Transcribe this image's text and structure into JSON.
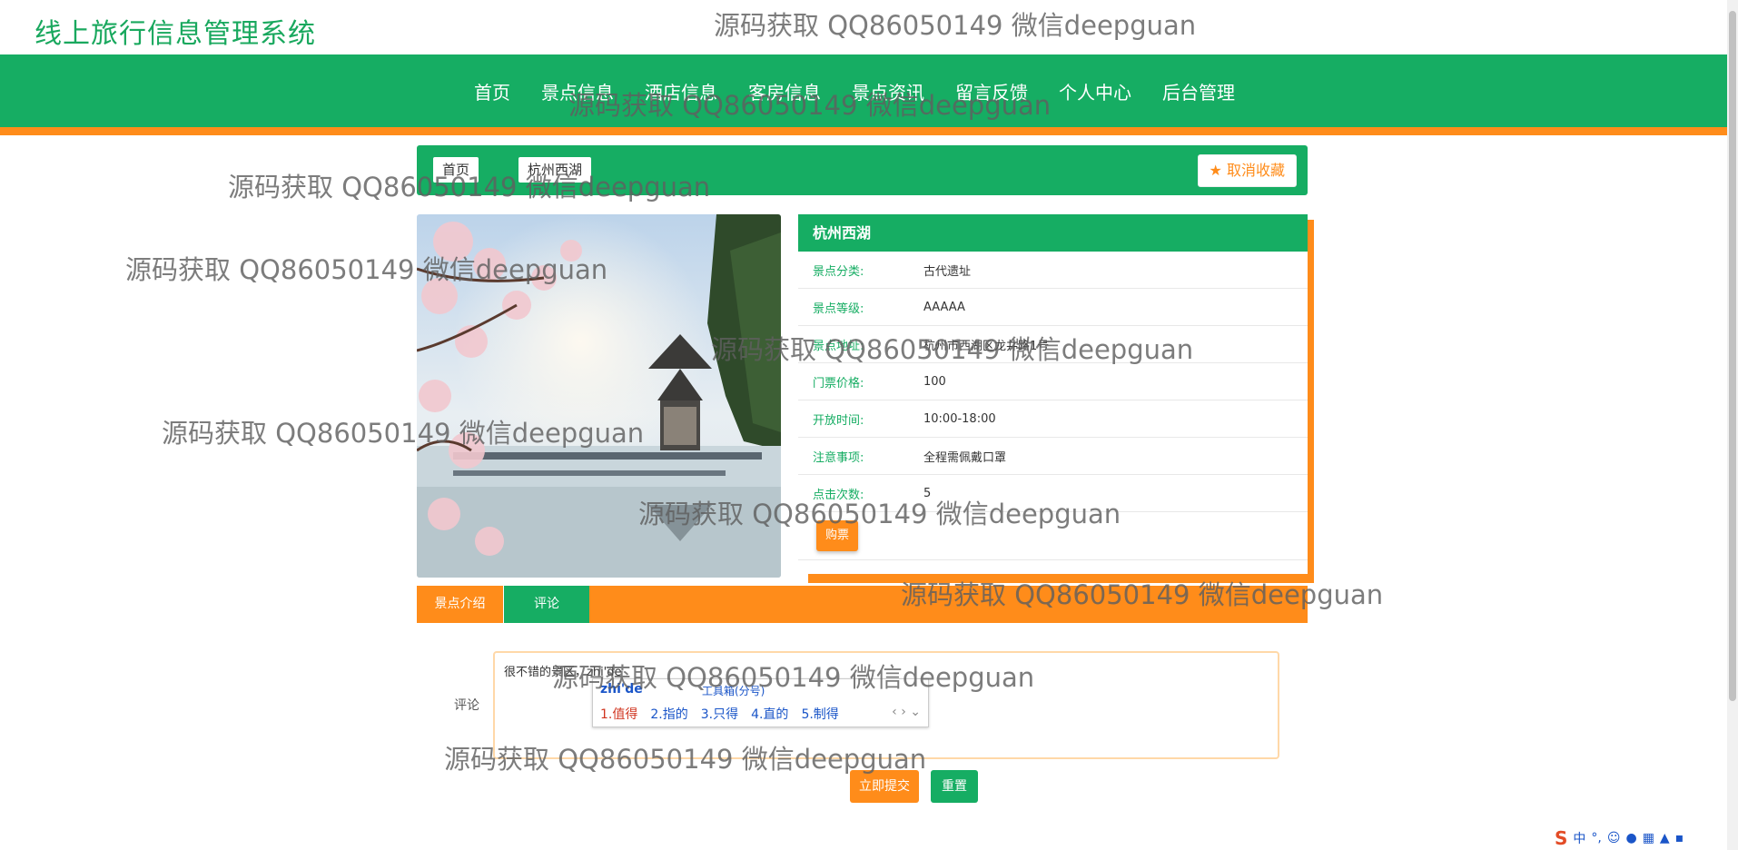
{
  "site": {
    "title": "线上旅行信息管理系统"
  },
  "watermark": "源码获取 QQ86050149 微信deepguan",
  "nav": {
    "items": [
      "首页",
      "景点信息",
      "酒店信息",
      "客房信息",
      "景点资讯",
      "留言反馈",
      "个人中心",
      "后台管理"
    ]
  },
  "breadcrumb": {
    "home": "首页",
    "current": "杭州西湖"
  },
  "favorite": {
    "label": "取消收藏",
    "icon": "star-icon"
  },
  "detail": {
    "title": "杭州西湖",
    "rows": [
      {
        "label": "景点分类:",
        "value": "古代遗址"
      },
      {
        "label": "景点等级:",
        "value": "AAAAA"
      },
      {
        "label": "景点地址:",
        "value": "杭州市西湖区龙井路1号"
      },
      {
        "label": "门票价格:",
        "value": "100"
      },
      {
        "label": "开放时间:",
        "value": "10:00-18:00"
      },
      {
        "label": "注意事项:",
        "value": "全程需佩戴口罩"
      },
      {
        "label": "点击次数:",
        "value": "5"
      }
    ],
    "buy_label": "购票"
  },
  "tabs": {
    "intro": "景点介绍",
    "comment": "评论"
  },
  "comment": {
    "label": "评论",
    "value": "很不错的景区，zhi'de"
  },
  "ime": {
    "pinyin": "zhi'de",
    "toolbox": "工具箱(分号)",
    "candidates": [
      "1.值得",
      "2.指的",
      "3.只得",
      "4.直的",
      "5.制得"
    ]
  },
  "buttons": {
    "submit": "立即提交",
    "reset": "重置"
  },
  "tray": {
    "lang": "中"
  },
  "colors": {
    "green": "#16ad63",
    "orange": "#ff8c1a"
  }
}
